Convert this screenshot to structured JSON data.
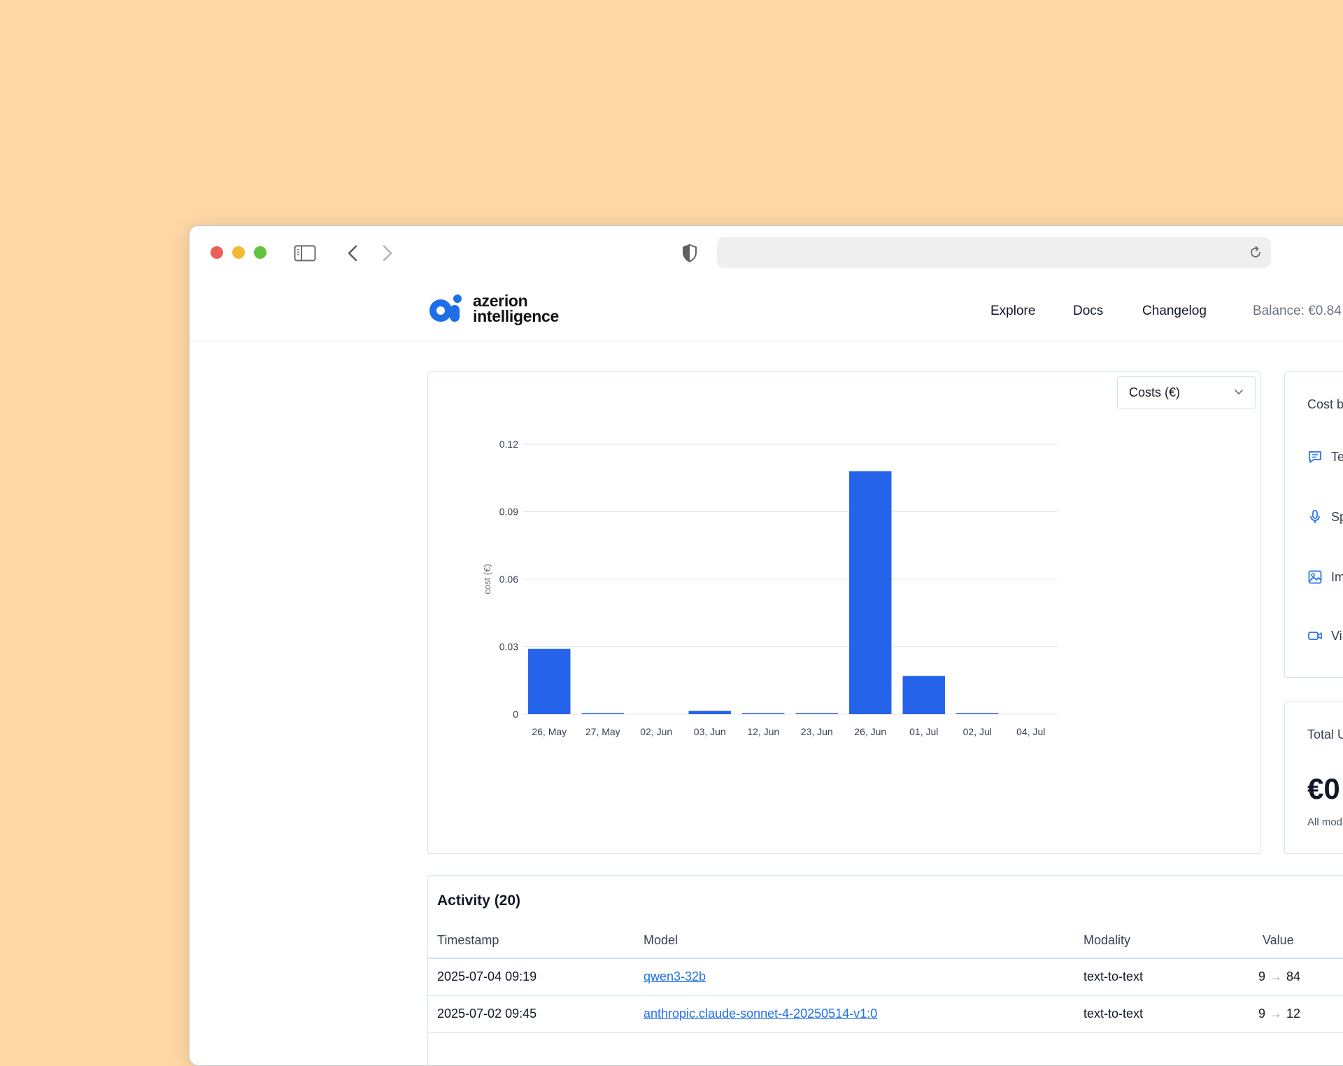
{
  "nav": {
    "logo_line1": "azerion",
    "logo_line2": "intelligence",
    "explore": "Explore",
    "docs": "Docs",
    "changelog": "Changelog",
    "balance": "Balance: €0.84"
  },
  "chart_selector": {
    "value": "Costs (€)"
  },
  "chart_data": {
    "type": "bar",
    "title": "",
    "xlabel": "",
    "ylabel": "cost (€)",
    "ylim": [
      0,
      0.12
    ],
    "yticks": [
      "0",
      "0.03",
      "0.06",
      "0.09",
      "0.12"
    ],
    "ytick_values": [
      0,
      0.03,
      0.06,
      0.09,
      0.12
    ],
    "categories": [
      "26, May",
      "27, May",
      "02, Jun",
      "03, Jun",
      "12, Jun",
      "23, Jun",
      "26, Jun",
      "01, Jul",
      "02, Jul",
      "04, Jul"
    ],
    "values": [
      0.029,
      0.0004,
      0.0,
      0.0015,
      0.0002,
      0.0002,
      0.108,
      0.017,
      0.0003,
      0.0
    ],
    "grid": true,
    "colors": {
      "bar": "#2563EB"
    }
  },
  "cost_card": {
    "title": "Cost b",
    "items": [
      {
        "label": "Te",
        "icon": "chat-icon"
      },
      {
        "label": "Sp",
        "icon": "microphone-icon"
      },
      {
        "label": "Im",
        "icon": "image-icon"
      },
      {
        "label": "Vi",
        "icon": "video-icon"
      }
    ]
  },
  "total_card": {
    "title": "Total U",
    "value": "€0",
    "note": "All mod"
  },
  "activity": {
    "title": "Activity (20)",
    "columns": [
      "Timestamp",
      "Model",
      "Modality",
      "Value"
    ],
    "rows": [
      {
        "timestamp": "2025-07-04 09:19",
        "model": "qwen3-32b",
        "modality": "text-to-text",
        "value_in": "9",
        "value_out": "84"
      },
      {
        "timestamp": "2025-07-02 09:45",
        "model": "anthropic.claude-sonnet-4-20250514-v1:0",
        "modality": "text-to-text",
        "value_in": "9",
        "value_out": "12"
      }
    ]
  }
}
